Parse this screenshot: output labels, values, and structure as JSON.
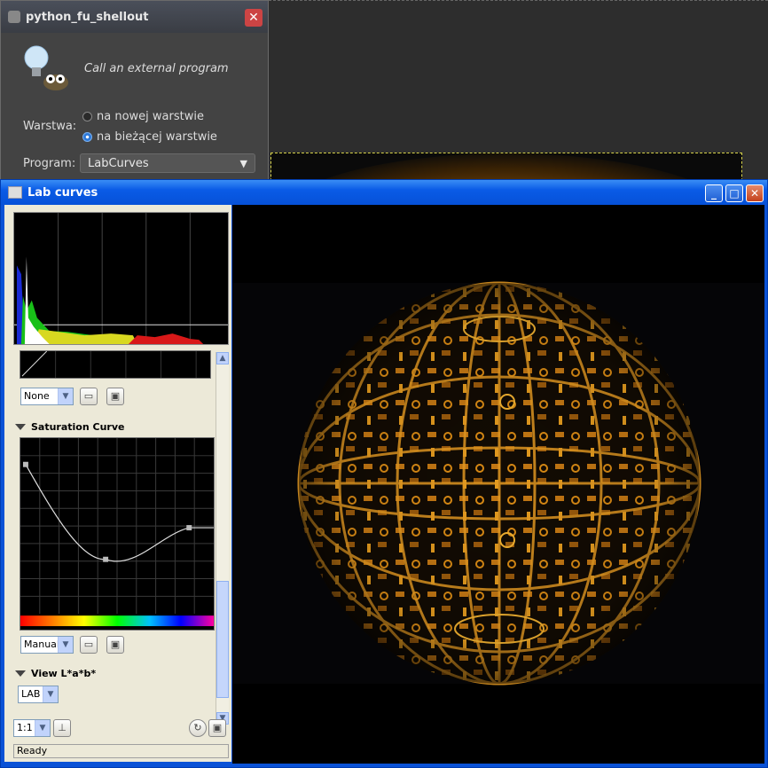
{
  "plugin_dialog": {
    "title": "python_fu_shellout",
    "close_label": "✕",
    "description": "Call an external program",
    "layer_label": "Warstwa:",
    "layer_options": [
      "na nowej warstwie",
      "na bieżącej warstwie"
    ],
    "layer_selected": 1,
    "program_label": "Program:",
    "program_value": "LabCurves",
    "program_arrow": "▼"
  },
  "lab_window": {
    "title": "Lab curves",
    "minimize": "_",
    "maximize": "□",
    "close": "✕",
    "curve_preset": "None",
    "saturation_title": "Saturation Curve",
    "saturation_mode": "Manual",
    "view_title": "View L*a*b*",
    "view_mode": "LAB",
    "zoom": "1:1",
    "status": "Ready"
  },
  "colors": {
    "titlebar_blue": "#0651d8",
    "panel_bg": "#ece9d8",
    "globe_orange": "#d98a14"
  }
}
